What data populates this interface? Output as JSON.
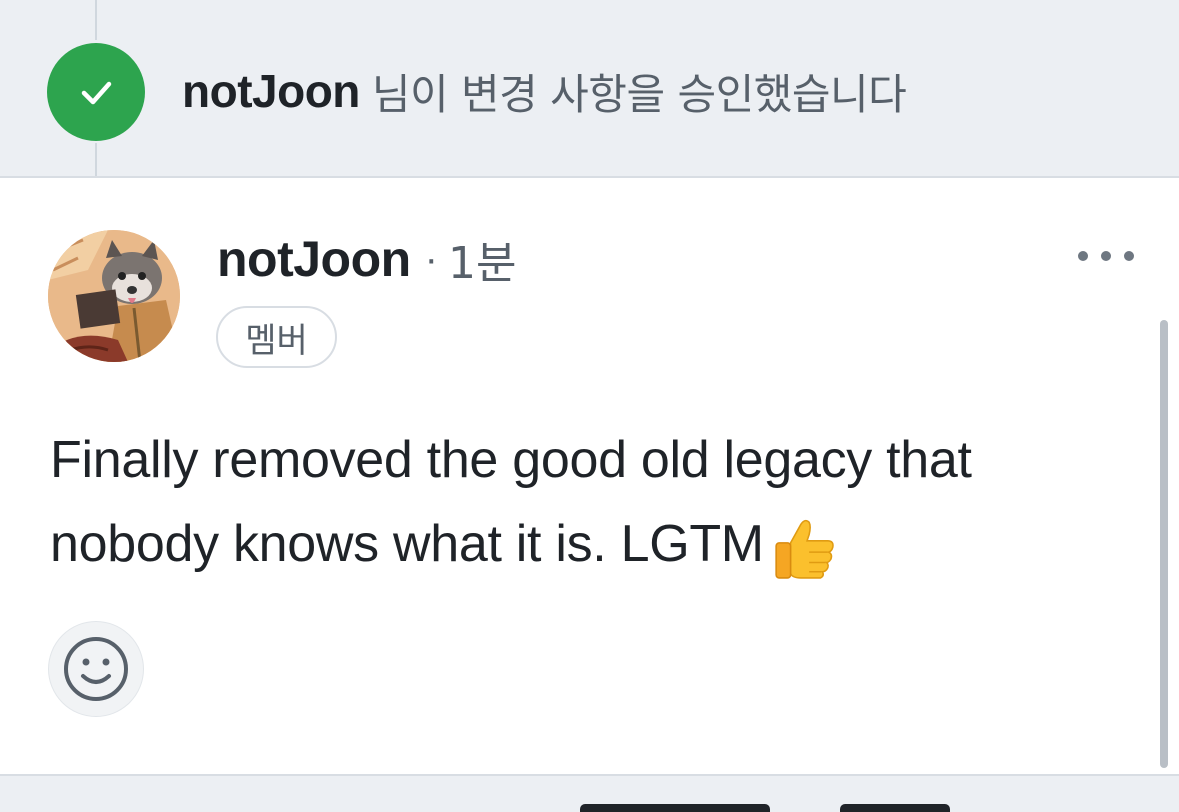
{
  "approval": {
    "user": "notJoon",
    "message": "님이 변경 사항을 승인했습니다"
  },
  "comment": {
    "author": "notJoon",
    "separator": "·",
    "time": "1분",
    "badge": "멤버",
    "body": "Finally removed the good old legacy that nobody knows what it is. LGTM",
    "emoji": "thumbs-up"
  },
  "icons": {
    "approval": "check-icon",
    "more": "more-dots-icon",
    "reaction": "smiley-icon"
  },
  "colors": {
    "approved_green": "#2da44e",
    "banner_bg": "#eceff3",
    "muted_text": "#57606a"
  }
}
